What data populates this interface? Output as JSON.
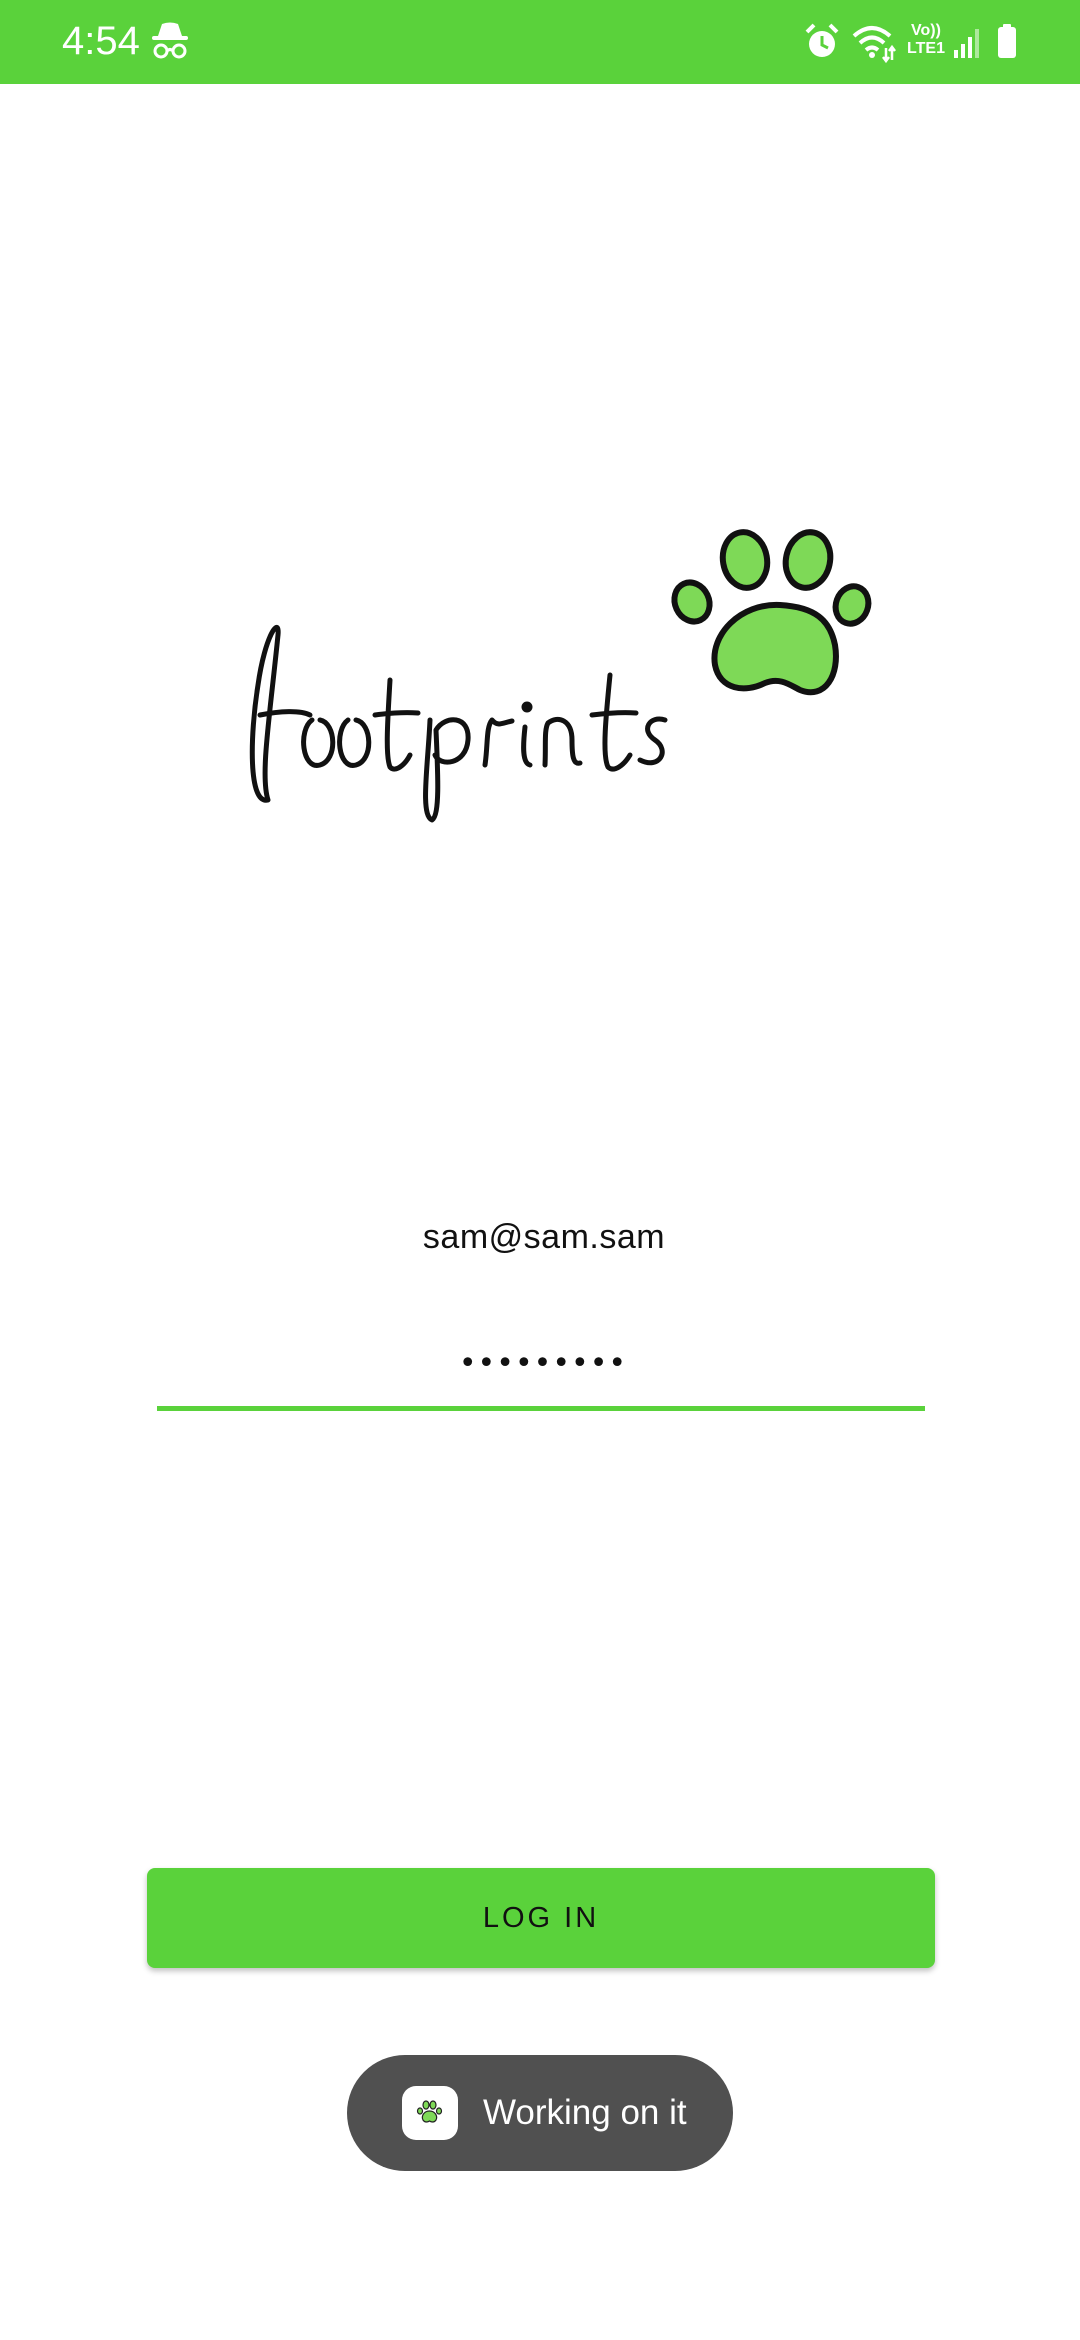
{
  "status_bar": {
    "time": "4:54",
    "network_label_top": "Vo))",
    "network_label_bottom": "LTE1",
    "icons": [
      "incognito-icon",
      "alarm-icon",
      "wifi-icon",
      "signal-icon",
      "battery-icon"
    ]
  },
  "brand": {
    "logo_text": "footprints",
    "accent_color": "#5ad23b"
  },
  "login_form": {
    "email_value": "sam@sam.sam",
    "password_value": "•••••••••",
    "login_label": "LOG IN"
  },
  "toast": {
    "message": "Working on it"
  }
}
